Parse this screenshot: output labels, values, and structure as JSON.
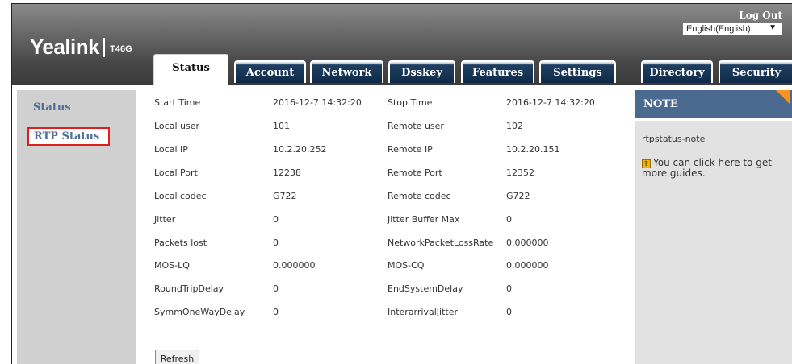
{
  "brand": {
    "logo": "Yealink",
    "model": "T46G"
  },
  "header": {
    "logout": "Log Out",
    "language": "English(English)"
  },
  "tabs": [
    {
      "label": "Status",
      "active": true
    },
    {
      "label": "Account"
    },
    {
      "label": "Network"
    },
    {
      "label": "Dsskey"
    },
    {
      "label": "Features"
    },
    {
      "label": "Settings"
    },
    {
      "label": "Directory"
    },
    {
      "label": "Security"
    }
  ],
  "sidebar": {
    "items": [
      {
        "label": "Status"
      },
      {
        "label": "RTP Status",
        "selected": true
      }
    ]
  },
  "rtp": {
    "rows": [
      [
        "Start Time",
        "2016-12-7 14:32:20",
        "Stop Time",
        "2016-12-7 14:32:20"
      ],
      [
        "Local user",
        "101",
        "Remote user",
        "102"
      ],
      [
        "Local IP",
        "10.2.20.252",
        "Remote IP",
        "10.2.20.151"
      ],
      [
        "Local Port",
        "12238",
        "Remote Port",
        "12352"
      ],
      [
        "Local codec",
        "G722",
        "Remote codec",
        "G722"
      ],
      [
        "Jitter",
        "0",
        "Jitter Buffer Max",
        "0"
      ],
      [
        "Packets lost",
        "0",
        "NetworkPacketLossRate",
        "0.000000"
      ],
      [
        "MOS-LQ",
        "0.000000",
        "MOS-CQ",
        "0.000000"
      ],
      [
        "RoundTripDelay",
        "0",
        "EndSystemDelay",
        "0"
      ],
      [
        "SymmOneWayDelay",
        "0",
        "InterarrivalJitter",
        "0"
      ]
    ],
    "refresh_label": "Refresh"
  },
  "note": {
    "title": "NOTE",
    "text": "rtpstatus-note",
    "guide": "You can click here to get more guides.",
    "icon": "help-icon"
  },
  "colors": {
    "header_bg": "#4a4a4a",
    "tab_bg": "#0f2a47",
    "sidebar_bg": "#d0d0d0",
    "note_header": "#4b6a90",
    "accent_orange": "#f7931e",
    "selected_border": "#e01e1e"
  }
}
